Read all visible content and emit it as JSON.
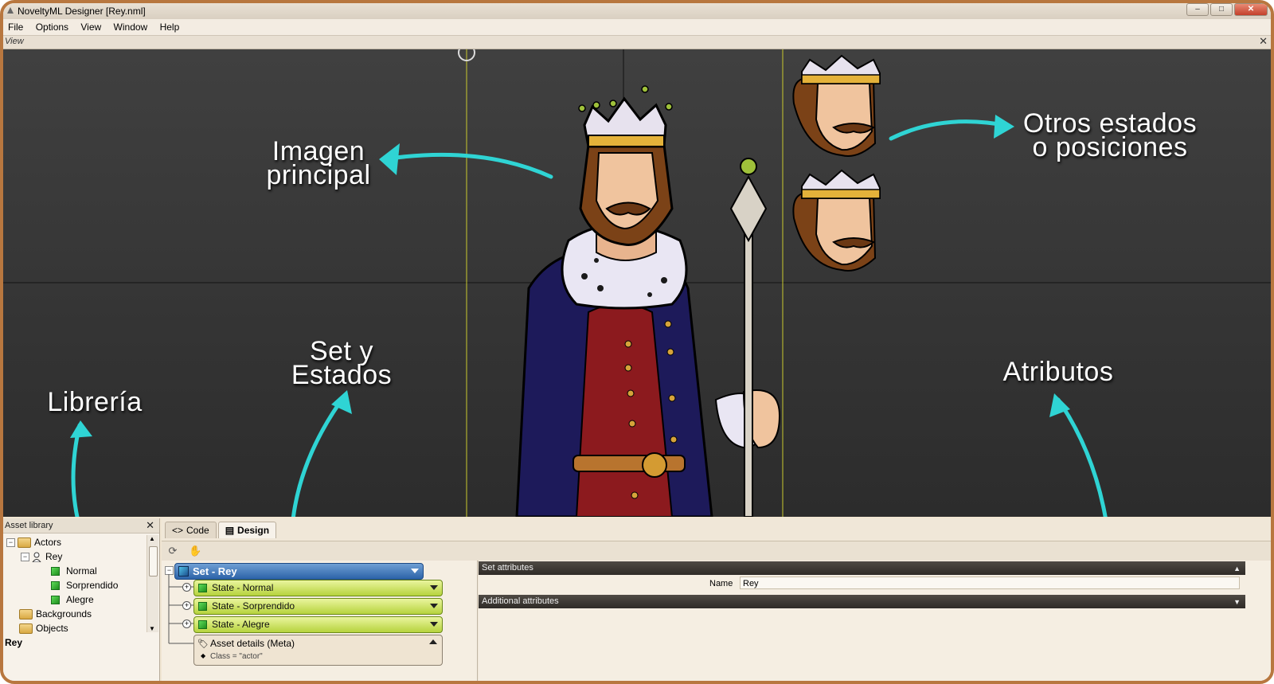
{
  "window": {
    "title": "NoveltyML Designer [Rey.nml]"
  },
  "menu": [
    "File",
    "Options",
    "View",
    "Window",
    "Help"
  ],
  "view_panel": {
    "label": "View"
  },
  "annotations": {
    "main_image": [
      "Imagen",
      "principal"
    ],
    "other_states": [
      "Otros estados",
      "o posiciones"
    ],
    "set_states": [
      "Set y",
      "Estados"
    ],
    "library": "Librería",
    "attributes": "Atributos"
  },
  "asset_library": {
    "title": "Asset library",
    "tree": [
      {
        "label": "Actors",
        "type": "folder",
        "level": 0,
        "expanded": true
      },
      {
        "label": "Rey",
        "type": "actor",
        "level": 1,
        "expanded": true
      },
      {
        "label": "Normal",
        "type": "state",
        "level": 2
      },
      {
        "label": "Sorprendido",
        "type": "state",
        "level": 2
      },
      {
        "label": "Alegre",
        "type": "state",
        "level": 2
      },
      {
        "label": "Backgrounds",
        "type": "folder",
        "level": 0
      },
      {
        "label": "Objects",
        "type": "folder",
        "level": 0
      }
    ],
    "selected": "Rey"
  },
  "design": {
    "tabs": [
      "Code",
      "Design"
    ],
    "active_tab": "Design",
    "set": {
      "label": "Set - Rey"
    },
    "states": [
      "State - Normal",
      "State - Sorprendido",
      "State - Alegre"
    ],
    "meta": {
      "label": "Asset details (Meta)",
      "class_line": "Class = \"actor\""
    }
  },
  "attributes": {
    "set_header": "Set attributes",
    "name_label": "Name",
    "name_value": "Rey",
    "additional_header": "Additional attributes"
  },
  "colors": {
    "frame": "#b8773f",
    "annotation_arrow": "#2fd4d4",
    "set_bar": "#2c63a8",
    "state_bar": "#b6d33d"
  }
}
